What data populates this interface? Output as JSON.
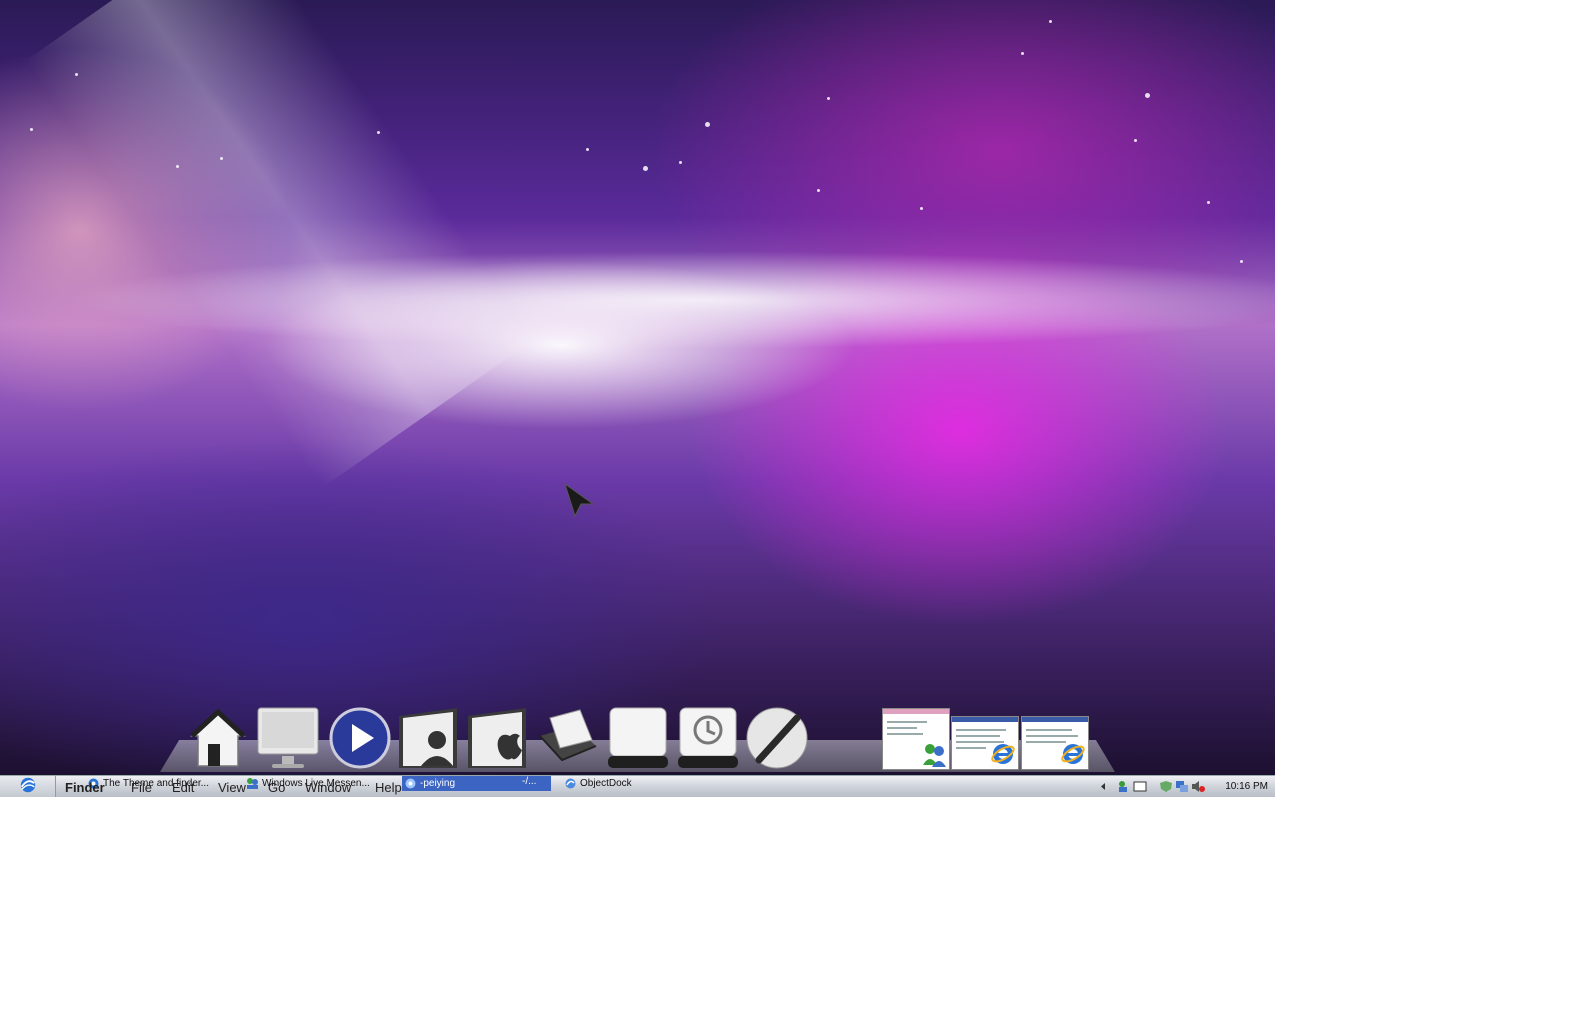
{
  "menubar": {
    "app_name": "Finder",
    "items": [
      "File",
      "Edit",
      "View",
      "Go",
      "Window",
      "Help"
    ]
  },
  "taskbar": {
    "tasks": [
      {
        "label": "The Theme and finder...",
        "icon": "ie-icon",
        "active": false
      },
      {
        "label": "Windows Live Messen...",
        "icon": "messenger-icon",
        "active": false
      },
      {
        "label": "-peiying",
        "secondary": "-/...",
        "icon": "ie-icon",
        "active": true
      },
      {
        "label": "ObjectDock",
        "icon": "objectdock-icon",
        "active": false
      }
    ],
    "clock": "10:16 PM"
  },
  "dock": {
    "items": [
      "home-icon",
      "computer-icon",
      "media-player-icon",
      "user-folder-icon",
      "applications-folder-icon",
      "mail-icon",
      "drive-icon",
      "time-machine-icon",
      "browser-sphere-icon"
    ],
    "running_windows": [
      "messenger-window-thumbnail",
      "ie-window-thumbnail",
      "ie-window-thumbnail"
    ]
  },
  "colors": {
    "taskbar": "#cfd3da",
    "active_task": "#3c64c2",
    "wallpaper_magenta": "#ee28e6"
  }
}
